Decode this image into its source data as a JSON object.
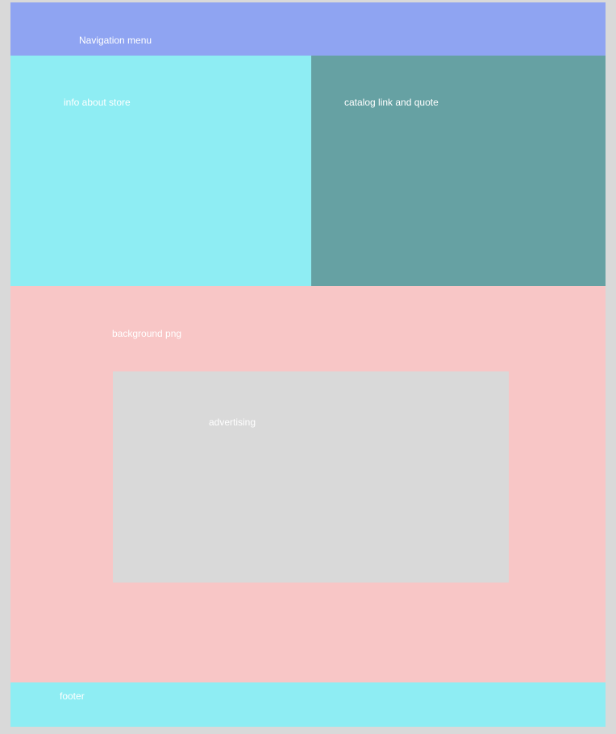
{
  "nav": {
    "label": "Navigation menu"
  },
  "info": {
    "label": "info about store"
  },
  "catalog": {
    "label": "catalog link and quote"
  },
  "background": {
    "label": "background png"
  },
  "advertising": {
    "label": "advertising"
  },
  "footer": {
    "label": "footer"
  },
  "colors": {
    "canvas": "#d9d9d9",
    "nav": "#8fa4f2",
    "info": "#8eedf3",
    "catalog": "#66a1a3",
    "background": "#f8c6c6",
    "advertising": "#d9d9d9",
    "footer": "#8eedf3",
    "text": "#ffffff"
  }
}
